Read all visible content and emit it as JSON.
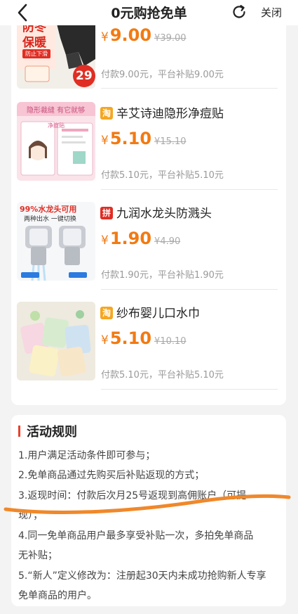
{
  "header": {
    "title": "0元购抢免单",
    "close_label": "关闭"
  },
  "products": [
    {
      "title": "",
      "platform": "",
      "currency": "¥",
      "price": "9.00",
      "original_price": "¥39.00",
      "subsidy_text": "付款9.00元，平台补贴9.00元",
      "thumb": {
        "tag_line1": "防冬",
        "tag_line2": "保暖",
        "tag_line3": "防止下滑",
        "price_tag": "29"
      }
    },
    {
      "title": "辛艾诗迪隐形净痘贴",
      "platform": "淘",
      "currency": "¥",
      "price": "5.10",
      "original_price": "¥15.10",
      "subsidy_text": "付款5.10元，平台补贴5.10元",
      "thumb": {
        "tag_line1": "隐形裁缝 有它就够",
        "tag_line2": "净痘贴"
      }
    },
    {
      "title": "九润水龙头防溅头",
      "platform": "拼",
      "currency": "¥",
      "price": "1.90",
      "original_price": "¥4.90",
      "subsidy_text": "付款1.90元，平台补贴1.90元",
      "thumb": {
        "tag_line1": "99%水龙头可用",
        "tag_line2": "两种出水 一键切换"
      }
    },
    {
      "title": "纱布婴儿口水巾",
      "platform": "淘",
      "currency": "¥",
      "price": "5.10",
      "original_price": "¥10.10",
      "subsidy_text": "付款5.10元，平台补贴5.10元",
      "thumb": {}
    }
  ],
  "rules": {
    "title": "活动规则",
    "items": [
      "1.用户满足活动条件即可参与；",
      "2.免单商品通过先购买后补贴返现的方式；",
      "3.返现时间：付款后次月25号返现到高佣账户（可提",
      "现）；",
      "4.同一免单商品用户最多享受补贴一次，多拍免单商品",
      "无补贴；",
      "5.“新人”定义修改为：注册起30天内未成功抢购新人专享",
      "免单商品的用户。"
    ]
  },
  "colors": {
    "price": "#f27a12",
    "accent": "#e8412c",
    "annotation": "#f0882a",
    "badge_taobao": "#f5a623",
    "badge_pdd": "#e02e24"
  },
  "icons": [
    "back-icon",
    "refresh-icon"
  ]
}
